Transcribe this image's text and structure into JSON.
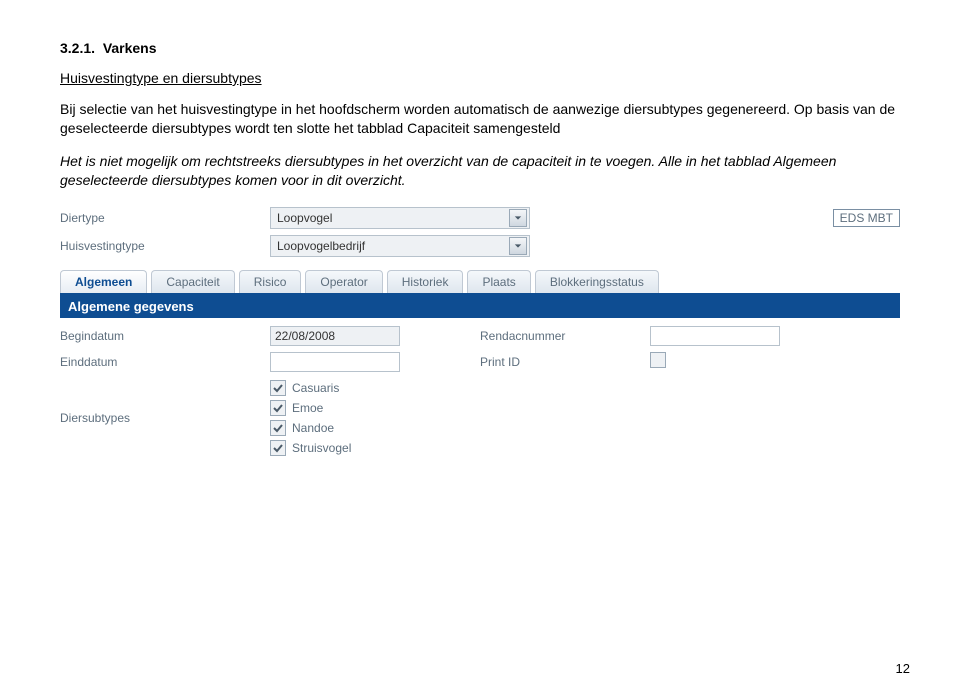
{
  "section": {
    "number": "3.2.1.",
    "title": "Varkens"
  },
  "subtitle": "Huisvestingtype en diersubtypes",
  "paragraph1": "Bij selectie van het huisvestingtype in het hoofdscherm worden automatisch de aanwezige diersubtypes gegenereerd. Op basis van de geselecteerde diersubtypes wordt ten slotte het tabblad Capaciteit samengesteld",
  "paragraph2": "Het is niet mogelijk om rechtstreeks diersubtypes in het overzicht van de capaciteit in te voegen. Alle in het tabblad Algemeen geselecteerde diersubtypes komen voor in dit overzicht.",
  "form": {
    "diertype_label": "Diertype",
    "diertype_value": "Loopvogel",
    "huis_label": "Huisvestingtype",
    "huis_value": "Loopvogelbedrijf",
    "right_box": "EDS MBT"
  },
  "tabs": [
    "Algemeen",
    "Capaciteit",
    "Risico",
    "Operator",
    "Historiek",
    "Plaats",
    "Blokkeringsstatus"
  ],
  "active_tab_index": 0,
  "section_head": "Algemene gegevens",
  "fields": {
    "begindatum_label": "Begindatum",
    "begindatum_value": "22/08/2008",
    "rendac_label": "Rendacnummer",
    "einddatum_label": "Einddatum",
    "print_label": "Print ID",
    "diersub_label": "Diersubtypes"
  },
  "subtypes": [
    "Casuaris",
    "Emoe",
    "Nandoe",
    "Struisvogel"
  ],
  "page_number": "12"
}
